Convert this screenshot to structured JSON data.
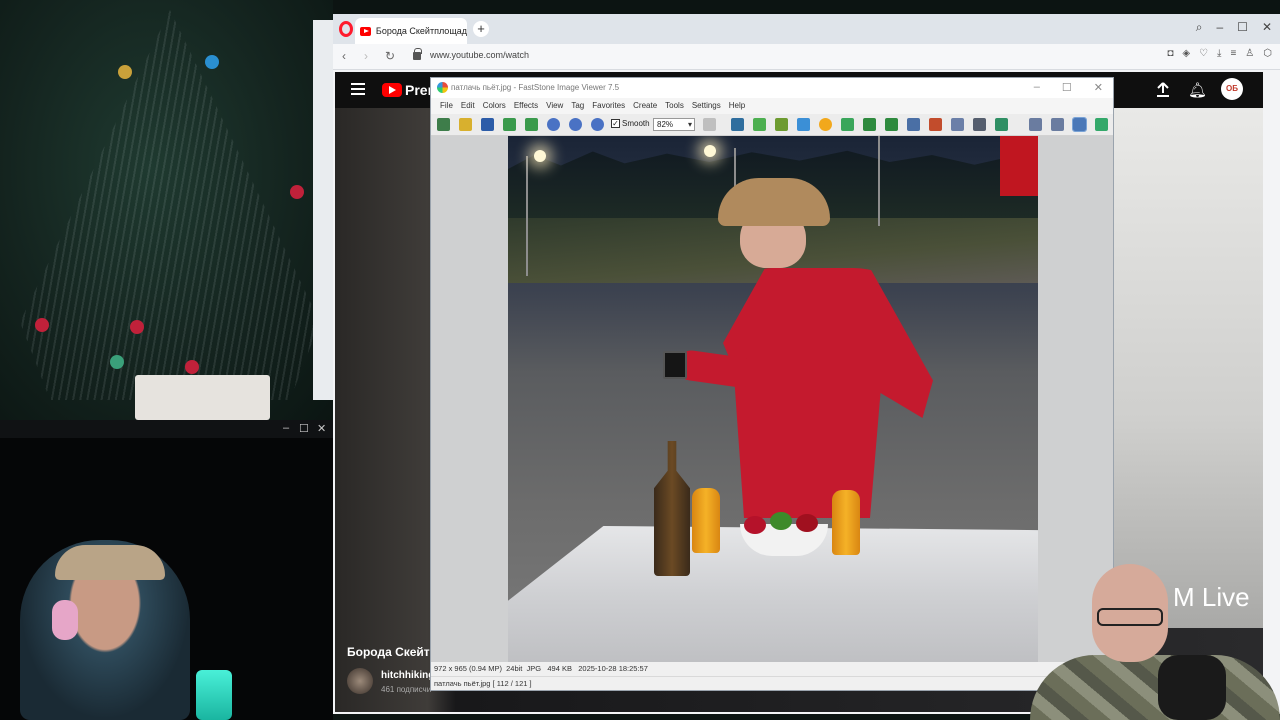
{
  "browser": {
    "tab_title": "Борода Скейтплощадка",
    "new_tab": "+",
    "url": "www.youtube.com/watch",
    "window_controls": {
      "search": "⌕",
      "minimize": "–",
      "maximize": "☐",
      "close": "✕"
    }
  },
  "youtube": {
    "brand": "Prem",
    "avatar_initials": "ОБ",
    "video_title": "Борода Скейт",
    "channel_name": "hitchhiking",
    "channel_subs": "461 подписчи",
    "live_badge": "M Live"
  },
  "faststone": {
    "title": "патлачь пьёт.jpg  -  FastStone Image Viewer 7.5",
    "menu": [
      "File",
      "Edit",
      "Colors",
      "Effects",
      "View",
      "Tag",
      "Favorites",
      "Create",
      "Tools",
      "Settings",
      "Help"
    ],
    "smooth_label": "Smooth",
    "smooth_checked": "✓",
    "zoom": "82%",
    "status_info": "972 x 965 (0.94 MP)  24bit  JPG   494 KB   2025-10-28 18:25:57",
    "status_file": "патлачь пьёт.jpg [ 112 / 121 ]"
  },
  "camera_window": {
    "minimize": "–",
    "maximize": "☐",
    "close": "✕"
  },
  "colors": {
    "opera_red": "#ff1b2d",
    "youtube_red": "#ff0000",
    "shirt_red": "#c41a2e"
  }
}
